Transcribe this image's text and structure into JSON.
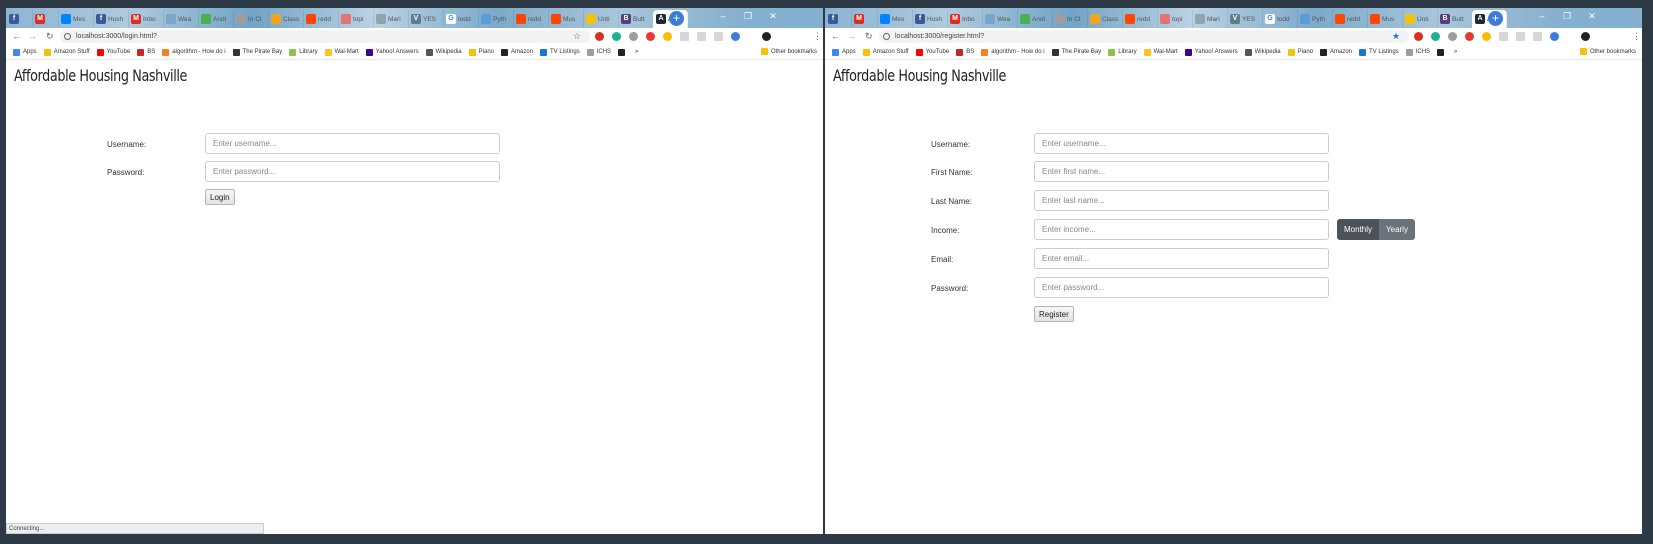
{
  "tabs": [
    {
      "icon": "facebook-icon",
      "label": "",
      "color": "#3b5998",
      "glyph": "f"
    },
    {
      "icon": "gmail-icon",
      "label": "",
      "color": "#d93025",
      "glyph": "M"
    },
    {
      "icon": "messenger-icon",
      "label": "Mes",
      "color": "#0084ff",
      "glyph": ""
    },
    {
      "icon": "facebook-icon",
      "label": "Hush",
      "color": "#3b5998",
      "glyph": "f"
    },
    {
      "icon": "gmail-icon",
      "label": "Inbo",
      "color": "#d93025",
      "glyph": "M"
    },
    {
      "icon": "page-icon",
      "label": "Wea",
      "color": "#7aa7c7",
      "glyph": ""
    },
    {
      "icon": "page-icon",
      "label": "Andi",
      "color": "#4caf50",
      "glyph": ""
    },
    {
      "icon": "page-icon",
      "label": "In Cl",
      "color": "#9e9e9e",
      "glyph": ""
    },
    {
      "icon": "page-icon",
      "label": "Class",
      "color": "#f4a31c",
      "glyph": ""
    },
    {
      "icon": "reddit-icon",
      "label": "redd",
      "color": "#ff4500",
      "glyph": ""
    },
    {
      "icon": "page-icon",
      "label": "topi",
      "color": "#e57373",
      "glyph": ""
    },
    {
      "icon": "page-icon",
      "label": "Mari",
      "color": "#90a4ae",
      "glyph": ""
    },
    {
      "icon": "vimeo-icon",
      "label": "YES",
      "color": "#607d8b",
      "glyph": "V"
    },
    {
      "icon": "google-icon",
      "label": "todd",
      "color": "#ffffff",
      "glyph": "G"
    },
    {
      "icon": "page-icon",
      "label": "Pyth",
      "color": "#5c9bd6",
      "glyph": ""
    },
    {
      "icon": "reddit-icon",
      "label": "redd",
      "color": "#ff4500",
      "glyph": ""
    },
    {
      "icon": "reddit-icon",
      "label": "Mus",
      "color": "#ff4500",
      "glyph": ""
    },
    {
      "icon": "folder-icon",
      "label": "Unti",
      "color": "#f4c20d",
      "glyph": ""
    },
    {
      "icon": "bootstrap-icon",
      "label": "Butt",
      "color": "#563d7c",
      "glyph": "B"
    },
    {
      "icon": "app-icon",
      "label": "A",
      "color": "#1b2a33",
      "glyph": "A",
      "active": true
    }
  ],
  "left": {
    "url": "localhost:3000/login.html?",
    "page_title": "Affordable Housing Nashville",
    "form": {
      "username_label": "Username:",
      "username_placeholder": "Enter username...",
      "password_label": "Password:",
      "password_placeholder": "Enter password...",
      "submit_label": "Login"
    },
    "status": "Connecting..."
  },
  "right": {
    "url": "localhost:3000/register.html?",
    "page_title": "Affordable Housing Nashville",
    "form": {
      "username_label": "Username:",
      "username_placeholder": "Enter username...",
      "first_name_label": "First Name:",
      "first_name_placeholder": "Enter first name...",
      "last_name_label": "Last Name:",
      "last_name_placeholder": "Enter last name...",
      "income_label": "Income:",
      "income_placeholder": "Enter income...",
      "income_period": [
        "Monthly",
        "Yearly"
      ],
      "email_label": "Email:",
      "email_placeholder": "Enter email...",
      "password_label": "Password:",
      "password_placeholder": "Enter password...",
      "submit_label": "Register"
    }
  },
  "bookmarks": [
    {
      "label": "Apps",
      "icon": "apps-icon",
      "color": "#4285f4"
    },
    {
      "label": "Amazon Stuff",
      "icon": "folder-icon",
      "color": "#f4c20d"
    },
    {
      "label": "YouTube",
      "icon": "youtube-icon",
      "color": "#ff0000"
    },
    {
      "label": "BS",
      "icon": "page-icon",
      "color": "#c62828"
    },
    {
      "label": "algorithm - How do i",
      "icon": "page-icon",
      "color": "#f48024"
    },
    {
      "label": "The Pirate Bay",
      "icon": "ship-icon",
      "color": "#333333"
    },
    {
      "label": "Library",
      "icon": "page-icon",
      "color": "#8bc34a"
    },
    {
      "label": "Wal-Mart",
      "icon": "walmart-icon",
      "color": "#ffc220"
    },
    {
      "label": "Yahoo! Answers",
      "icon": "yahoo-icon",
      "color": "#410093"
    },
    {
      "label": "Wikipedia",
      "icon": "wikipedia-icon",
      "color": "#555555"
    },
    {
      "label": "Piano",
      "icon": "folder-icon",
      "color": "#f4c20d"
    },
    {
      "label": "Amazon",
      "icon": "amazon-icon",
      "color": "#222222"
    },
    {
      "label": "TV Listings",
      "icon": "page-icon",
      "color": "#1976d2"
    },
    {
      "label": "ICHS",
      "icon": "doc-icon",
      "color": "#9e9e9e"
    },
    {
      "label": "",
      "icon": "camera-icon",
      "color": "#222222"
    }
  ],
  "other_bookmarks": "Other bookmarks",
  "more_bookmarks": "»"
}
